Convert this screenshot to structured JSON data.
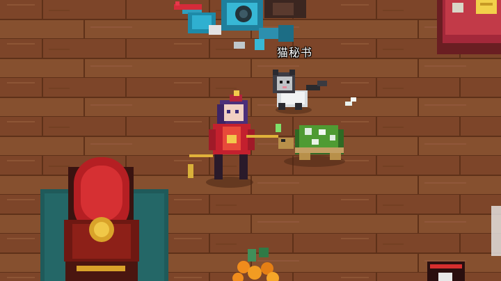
{
  "npc": {
    "name_label": "猫秘书"
  }
}
